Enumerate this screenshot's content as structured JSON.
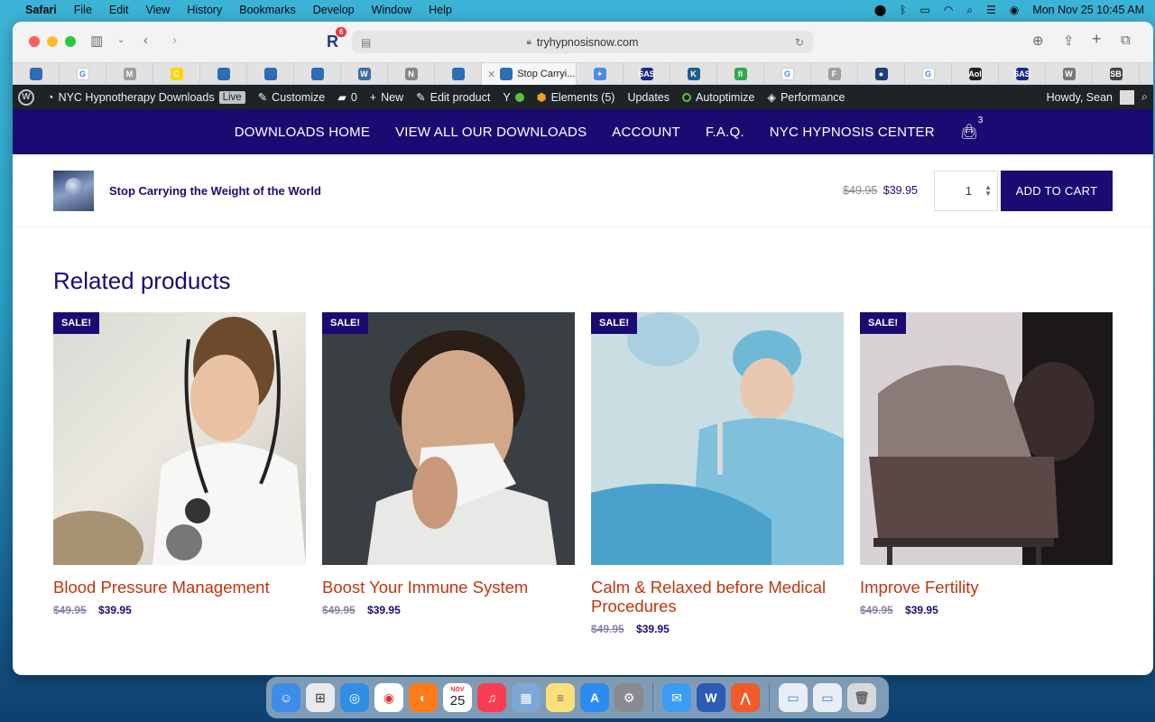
{
  "menubar": {
    "app": "Safari",
    "items": [
      "File",
      "Edit",
      "View",
      "History",
      "Bookmarks",
      "Develop",
      "Window",
      "Help"
    ],
    "datetime": "Mon Nov 25  10:45 AM"
  },
  "browser": {
    "url": "tryhypnosisnow.com",
    "extension_badge": "6",
    "active_tab_title": "Stop Carryi...",
    "tab_favicons": [
      {
        "icon": "site-favicon",
        "color": "#2d6db5",
        "label": ""
      },
      {
        "icon": "google-icon",
        "color": "#ffffff",
        "label": "G"
      },
      {
        "icon": "gmail-icon",
        "color": "#9e9e9e",
        "label": "M"
      },
      {
        "icon": "mailchimp-icon",
        "color": "#ffd500",
        "label": "C"
      },
      {
        "icon": "site-favicon",
        "color": "#2d6db5",
        "label": ""
      },
      {
        "icon": "site-favicon",
        "color": "#2d6db5",
        "label": ""
      },
      {
        "icon": "site-favicon",
        "color": "#2d6db5",
        "label": ""
      },
      {
        "icon": "wordpress-icon",
        "color": "#3c6ea6",
        "label": "W"
      },
      {
        "icon": "notion-icon",
        "color": "#888888",
        "label": "N"
      },
      {
        "icon": "site-favicon",
        "color": "#2d6db5",
        "label": ""
      }
    ],
    "tab_favicons_right": [
      {
        "icon": "sparkle-icon",
        "color": "#4a8be8",
        "label": "✦"
      },
      {
        "icon": "sas-icon",
        "color": "#1c2a8c",
        "label": "SAS"
      },
      {
        "icon": "k-icon",
        "color": "#1a5f8c",
        "label": "K"
      },
      {
        "icon": "fi-icon",
        "color": "#2fa84f",
        "label": "fi"
      },
      {
        "icon": "google-icon",
        "color": "#ffffff",
        "label": "G"
      },
      {
        "icon": "f-icon",
        "color": "#9e9e9e",
        "label": "F"
      },
      {
        "icon": "globe-icon",
        "color": "#1d3f7a",
        "label": "●"
      },
      {
        "icon": "google-icon",
        "color": "#ffffff",
        "label": "G"
      },
      {
        "icon": "aol-icon",
        "color": "#222222",
        "label": "Aol"
      },
      {
        "icon": "sas-icon",
        "color": "#1c2a8c",
        "label": "SAS"
      },
      {
        "icon": "wordpress-icon",
        "color": "#777777",
        "label": "W"
      },
      {
        "icon": "sb-icon",
        "color": "#444444",
        "label": "SB"
      }
    ]
  },
  "adminbar": {
    "site_name": "NYC Hypnotherapy Downloads",
    "live_label": "Live",
    "customize": "Customize",
    "comments_count": "0",
    "new_label": "New",
    "edit_product": "Edit product",
    "elements": "Elements (5)",
    "updates": "Updates",
    "autoptimize": "Autoptimize",
    "performance": "Performance",
    "howdy": "Howdy, Sean"
  },
  "sitenav": {
    "items": [
      "DOWNLOADS HOME",
      "VIEW ALL OUR DOWNLOADS",
      "ACCOUNT",
      "F.A.Q.",
      "NYC HYPNOSIS CENTER"
    ],
    "cart_count": "3"
  },
  "product_bar": {
    "name": "Stop Carrying the Weight of the World",
    "old_price": "$49.95",
    "price": "$39.95",
    "quantity": "1",
    "add_to_cart": "ADD TO CART"
  },
  "related": {
    "heading": "Related products",
    "sale_label": "SALE!",
    "products": [
      {
        "title": "Blood Pressure Management",
        "old_price": "$49.95",
        "price": "$39.95"
      },
      {
        "title": "Boost Your Immune System",
        "old_price": "$49.95",
        "price": "$39.95"
      },
      {
        "title": "Calm & Relaxed before Medical Procedures",
        "old_price": "$49.95",
        "price": "$39.95"
      },
      {
        "title": "Improve Fertility",
        "old_price": "$49.95",
        "price": "$39.95"
      }
    ]
  },
  "dock": {
    "calendar_month": "NOV",
    "calendar_day": "25",
    "apps": [
      "finder-icon",
      "launchpad-icon",
      "safari-icon",
      "chrome-icon",
      "firefox-icon",
      "calendar-icon",
      "music-icon",
      "preview-icon",
      "notes-icon",
      "appstore-icon",
      "system-settings-icon",
      "mail-icon",
      "word-icon",
      "transmit-icon",
      "downloads-stack-icon",
      "documents-stack-icon",
      "trash-icon"
    ]
  },
  "colors": {
    "brand": "#1c0a73",
    "link": "#c0360c",
    "adminbar": "#1d2327"
  }
}
